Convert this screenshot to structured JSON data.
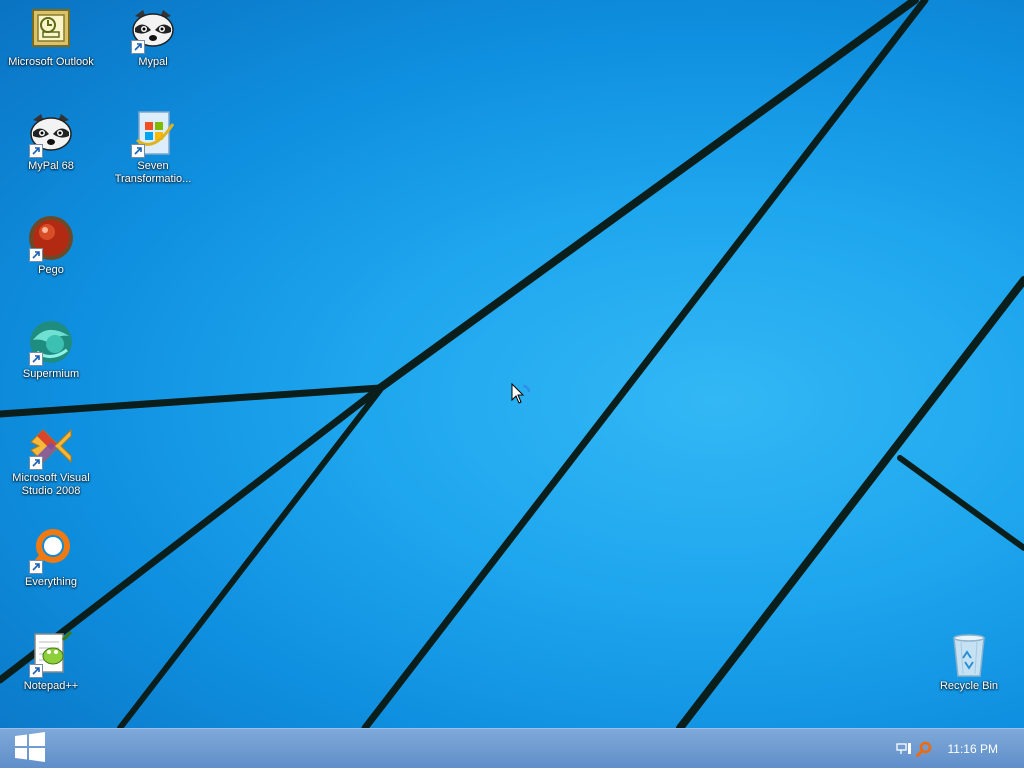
{
  "desktop": {
    "icons": [
      {
        "label": "Microsoft Outlook",
        "icon": "outlook-icon"
      },
      {
        "label": "Mypal",
        "icon": "mypal-raccoon-icon"
      },
      {
        "label": "MyPal 68",
        "icon": "mypal68-raccoon-icon"
      },
      {
        "label": "Seven Transformatio...",
        "icon": "seven-transformation-icon"
      },
      {
        "label": "Pego",
        "icon": "pego-icon"
      },
      {
        "label": "Supermium",
        "icon": "supermium-icon"
      },
      {
        "label": "Microsoft Visual Studio 2008",
        "icon": "visual-studio-icon"
      },
      {
        "label": "Everything",
        "icon": "everything-search-icon"
      },
      {
        "label": "Notepad++",
        "icon": "notepadpp-icon"
      },
      {
        "label": "Recycle Bin",
        "icon": "recycle-bin-icon"
      }
    ]
  },
  "taskbar": {
    "start_icon": "windows-logo-icon",
    "tray_icons": [
      "network-icon",
      "everything-tray-icon"
    ],
    "clock": "11:16 PM"
  },
  "colors": {
    "wallpaper": "#1ea6ee",
    "taskbar": "#6f9bd1",
    "line": "#0b1f1f"
  }
}
